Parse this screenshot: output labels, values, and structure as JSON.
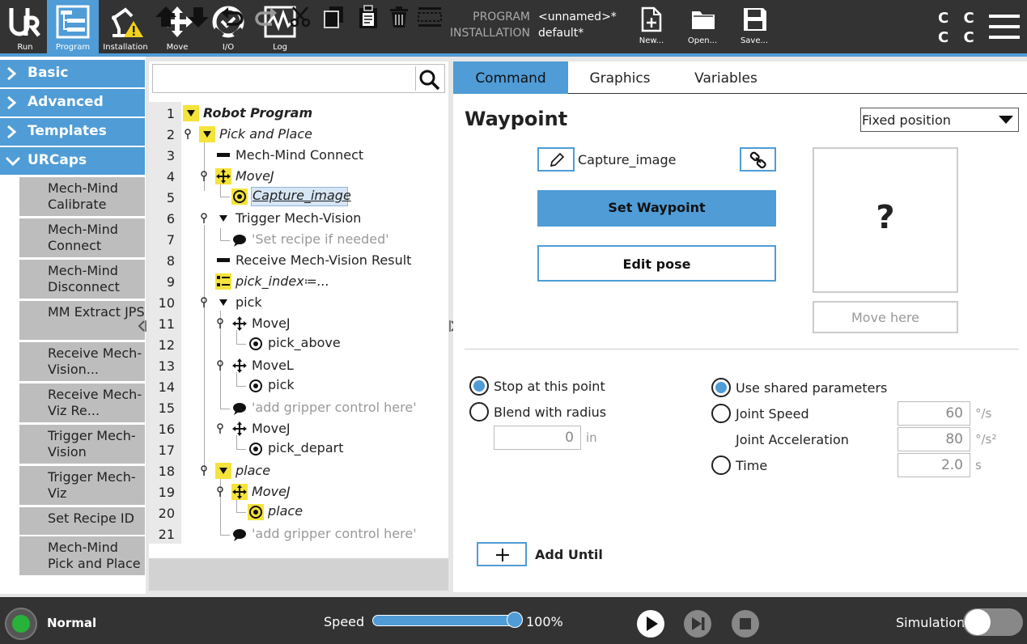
{
  "header": {
    "nav": [
      {
        "id": "run",
        "label": "Run",
        "icon": "ur-logo-icon"
      },
      {
        "id": "program",
        "label": "Program",
        "icon": "program-tree-icon",
        "active": true
      },
      {
        "id": "installation",
        "label": "Installation",
        "icon": "robot-arm-warning-icon"
      },
      {
        "id": "move",
        "label": "Move",
        "icon": "move-arrows-icon"
      },
      {
        "id": "io",
        "label": "I/O",
        "icon": "io-icon"
      },
      {
        "id": "log",
        "label": "Log",
        "icon": "log-graph-icon"
      }
    ],
    "program_label": "PROGRAM",
    "program_value": "<unnamed>*",
    "installation_label": "INSTALLATION",
    "installation_value": "default*",
    "file_buttons": {
      "new": "New...",
      "open": "Open...",
      "save": "Save..."
    },
    "cc_top": "C C",
    "cc_bottom": "C C"
  },
  "categories": {
    "basic": "Basic",
    "advanced": "Advanced",
    "templates": "Templates",
    "urcaps": "URCaps",
    "urcap_items": [
      "Mech-Mind Calibrate",
      "Mech-Mind Connect",
      "Mech-Mind Disconnect",
      "MM Extract JPS",
      "Receive Mech-Vision...",
      "Receive Mech-Viz Re...",
      "Trigger Mech-Vision",
      "Trigger Mech-Viz",
      "Set Recipe ID",
      "Mech-Mind Pick and Place"
    ]
  },
  "tree": {
    "line_numbers": [
      "1",
      "2",
      "3",
      "4",
      "5",
      "6",
      "7",
      "8",
      "9",
      "10",
      "11",
      "12",
      "13",
      "14",
      "15",
      "16",
      "17",
      "18",
      "19",
      "20",
      "21"
    ],
    "nodes": [
      "Robot Program",
      "Pick and Place",
      "Mech-Mind Connect",
      "MoveJ",
      "Capture_image",
      "Trigger Mech-Vision",
      "'Set recipe if needed'",
      "Receive Mech-Vision Result",
      "pick_index≔...",
      "pick",
      "MoveJ",
      "pick_above",
      "MoveL",
      "pick",
      "'add gripper control here'",
      "MoveJ",
      "pick_depart",
      "place",
      "MoveJ",
      "place",
      "'add gripper control here'"
    ]
  },
  "tabs": {
    "command": "Command",
    "graphics": "Graphics",
    "variables": "Variables"
  },
  "waypoint": {
    "title": "Waypoint",
    "position_type": "Fixed position",
    "name": "Capture_image",
    "set_waypoint": "Set Waypoint",
    "edit_pose": "Edit pose",
    "preview": "?",
    "move_here": "Move here",
    "stop_at_point": "Stop at this point",
    "blend_with_radius": "Blend with radius",
    "blend_value": "0",
    "blend_unit": "in",
    "use_shared": "Use shared parameters",
    "joint_speed": "Joint Speed",
    "joint_speed_value": "60",
    "joint_speed_unit": "°/s",
    "joint_accel": "Joint Acceleration",
    "joint_accel_value": "80",
    "joint_accel_unit": "°/s²",
    "time": "Time",
    "time_value": "2.0",
    "time_unit": "s",
    "add_until": "Add Until"
  },
  "footer": {
    "status": "Normal",
    "speed_label": "Speed",
    "speed_value": "100%",
    "speed_fraction": 1.0,
    "simulation_label": "Simulation",
    "simulation_on": false
  },
  "colors": {
    "accent": "#4f9cd6",
    "header_bg": "#333333",
    "status_ok": "#27b33a",
    "node_yellow": "#f4e33b"
  }
}
